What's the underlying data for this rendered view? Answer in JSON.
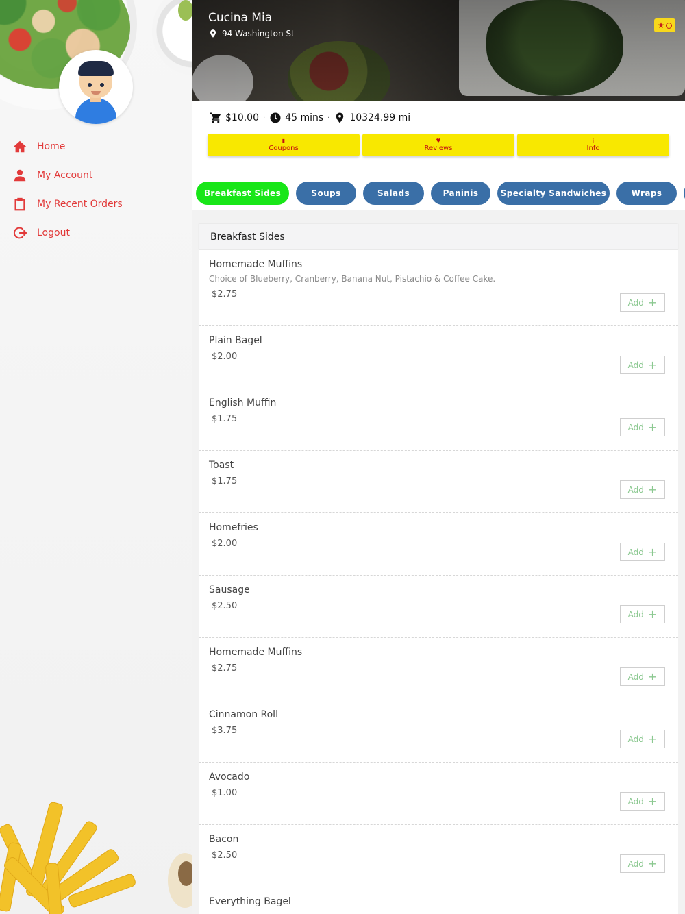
{
  "sidebar": {
    "items": [
      {
        "label": "Home",
        "icon": "home-icon"
      },
      {
        "label": "My Account",
        "icon": "person-icon"
      },
      {
        "label": "My Recent Orders",
        "icon": "clipboard-icon"
      },
      {
        "label": "Logout",
        "icon": "logout-icon"
      }
    ]
  },
  "restaurant": {
    "name": "Cucina Mia",
    "address": "94 Washington St",
    "rating_badge": "★"
  },
  "stats": {
    "price": "$10.00",
    "time": "45 mins",
    "distance": "10324.99 mi",
    "separator": "·"
  },
  "actions": [
    {
      "label": "Coupons",
      "icon": "bookmark-icon",
      "glyph": "▮"
    },
    {
      "label": "Reviews",
      "icon": "heart-icon",
      "glyph": "♥"
    },
    {
      "label": "Info",
      "icon": "info-icon",
      "glyph": "i"
    }
  ],
  "tabs": [
    "Breakfast Sides",
    "Soups",
    "Salads",
    "Paninis",
    "Specialty Sandwiches",
    "Wraps"
  ],
  "section": {
    "title": "Breakfast Sides",
    "add_label": "Add",
    "add_plus": "+",
    "items": [
      {
        "name": "Homemade Muffins",
        "desc": "Choice of Blueberry, Cranberry, Banana Nut, Pistachio & Coffee Cake.",
        "price": "$2.75"
      },
      {
        "name": "Plain Bagel",
        "price": "$2.00"
      },
      {
        "name": "English Muffin",
        "price": "$1.75"
      },
      {
        "name": "Toast",
        "price": "$1.75"
      },
      {
        "name": "Homefries",
        "price": "$2.00"
      },
      {
        "name": "Sausage",
        "price": "$2.50"
      },
      {
        "name": "Homemade Muffins",
        "price": "$2.75"
      },
      {
        "name": "Cinnamon Roll",
        "price": "$3.75"
      },
      {
        "name": "Avocado",
        "price": "$1.00"
      },
      {
        "name": "Bacon",
        "price": "$2.50"
      },
      {
        "name": "Everything Bagel"
      }
    ]
  },
  "colors": {
    "accent_red": "#e23a3a",
    "tab_blue": "#3a6fa7",
    "tab_active_green": "#18e618",
    "action_yellow": "#f8e800",
    "add_green": "#8bc890"
  }
}
